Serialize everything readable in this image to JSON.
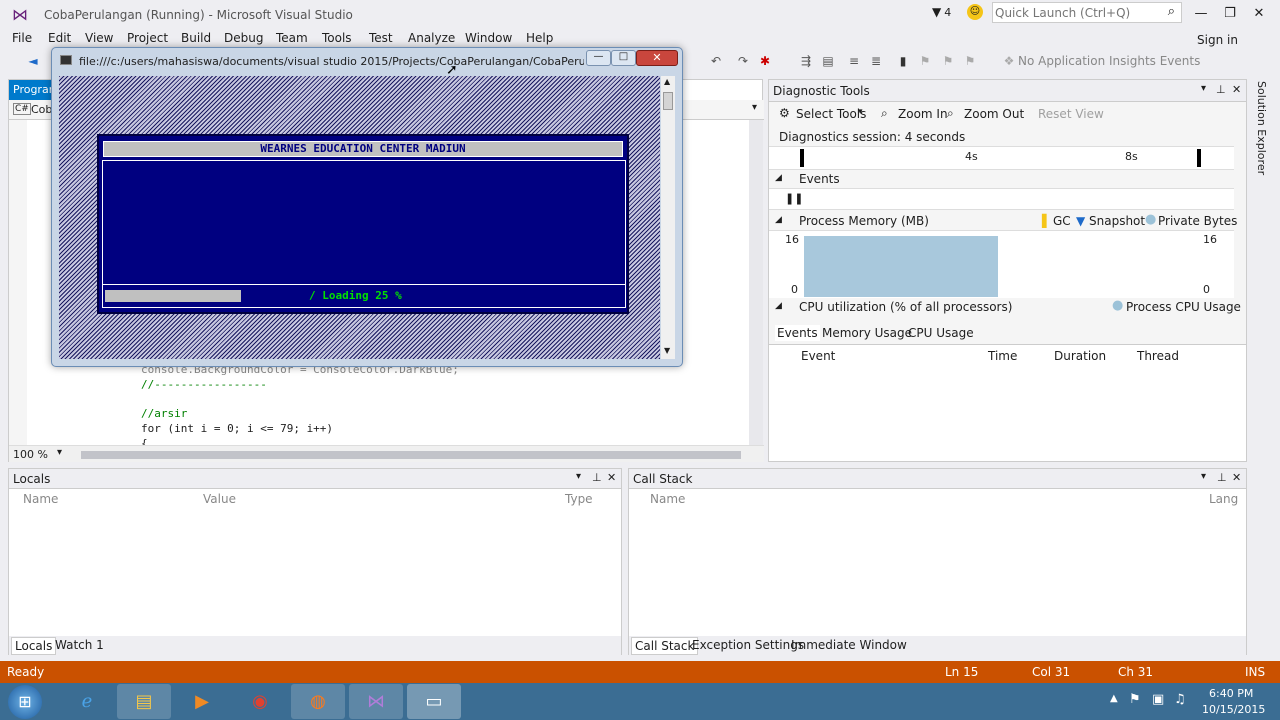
{
  "window": {
    "title": "CobaPerulangan (Running) - Microsoft Visual Studio",
    "notif_count": "4",
    "quick_launch_placeholder": "Quick Launch (Ctrl+Q)",
    "sign_in": "Sign in"
  },
  "menu": [
    "File",
    "Edit",
    "View",
    "Project",
    "Build",
    "Debug",
    "Team",
    "Tools",
    "Test",
    "Analyze",
    "Window",
    "Help"
  ],
  "toolbar": {
    "insights": "No Application Insights Events"
  },
  "editor": {
    "tab1": "Program",
    "tab2": "Cob",
    "zoom": "100 %",
    "lines": [
      "console.BackgroundColor = ConsoleColor.DarkBlue;",
      "//-----------------",
      "",
      "//arsir",
      "for (int i = 0; i <= 79; i++)",
      "{"
    ]
  },
  "console": {
    "path": "file:///c:/users/mahasiswa/documents/visual studio 2015/Projects/CobaPerulangan/CobaPerulang...",
    "banner": "WEARNES EDUCATION CENTER MADIUN",
    "loading": "/ Loading 25 %",
    "progress": 0.25
  },
  "diagnostic": {
    "title": "Diagnostic Tools",
    "select_tools": "Select Tools",
    "zoom_in": "Zoom In",
    "zoom_out": "Zoom Out",
    "reset_view": "Reset View",
    "session": "Diagnostics session: 4 seconds",
    "tick1": "4s",
    "tick2": "8s",
    "events": "Events",
    "process_memory": "Process Memory (MB)",
    "gc": "GC",
    "snapshot": "Snapshot",
    "private_bytes": "Private Bytes",
    "ymax_left": "16",
    "ymin_left": "0",
    "ymax_right": "16",
    "ymin_right": "0",
    "cpu": "CPU utilization (% of all processors)",
    "process_cpu": "Process CPU Usage",
    "tabs": [
      "Events",
      "Memory Usage",
      "CPU Usage"
    ],
    "cols": [
      "Event",
      "Time",
      "Duration",
      "Thread"
    ]
  },
  "locals": {
    "title": "Locals",
    "cols": [
      "Name",
      "Value",
      "Type"
    ],
    "tabs": [
      "Locals",
      "Watch 1"
    ]
  },
  "callstack": {
    "title": "Call Stack",
    "cols": [
      "Name",
      "Lang"
    ],
    "tabs": [
      "Call Stack",
      "Exception Settings",
      "Immediate Window"
    ]
  },
  "solution_explorer": "Solution Explorer",
  "status": {
    "ready": "Ready",
    "ln": "Ln 15",
    "col": "Col 31",
    "ch": "Ch 31",
    "ins": "INS"
  },
  "clock": {
    "time": "6:40 PM",
    "date": "10/15/2015"
  }
}
